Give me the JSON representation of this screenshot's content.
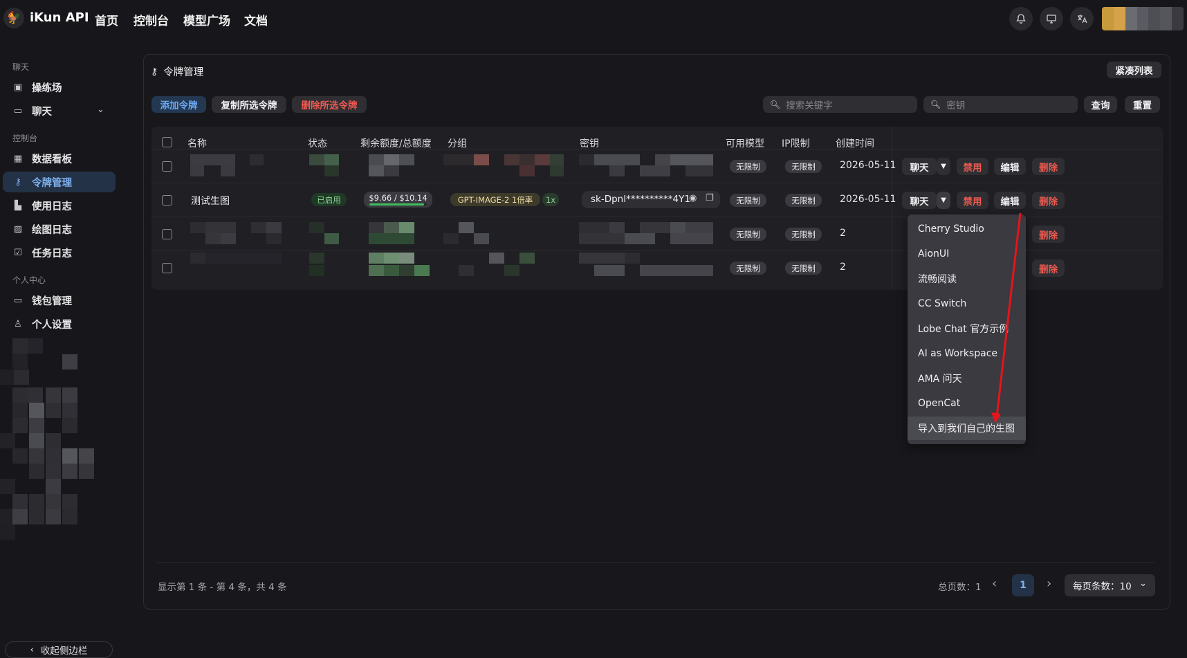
{
  "header": {
    "brand": "iKun API",
    "nav": [
      "首页",
      "控制台",
      "模型广场",
      "文档"
    ]
  },
  "sidebar": {
    "section_chat": "聊天",
    "section_console": "控制台",
    "section_personal": "个人中心",
    "items": [
      {
        "label": "操练场",
        "icon": "playground-icon"
      },
      {
        "label": "聊天",
        "icon": "chat-icon"
      },
      {
        "label": "数据看板",
        "icon": "dashboard-icon"
      },
      {
        "label": "令牌管理",
        "icon": "key-icon"
      },
      {
        "label": "使用日志",
        "icon": "chart-icon"
      },
      {
        "label": "绘图日志",
        "icon": "image-icon"
      },
      {
        "label": "任务日志",
        "icon": "task-icon"
      },
      {
        "label": "钱包管理",
        "icon": "wallet-icon"
      },
      {
        "label": "个人设置",
        "icon": "user-icon"
      }
    ],
    "collapse_label": "收起侧边栏"
  },
  "card": {
    "title": "令牌管理",
    "compact_button": "紧凑列表",
    "add_button": "添加令牌",
    "copy_button": "复制所选令牌",
    "delete_button": "删除所选令牌",
    "search_placeholder": "搜索关键字",
    "key_placeholder": "密钥",
    "query_button": "查询",
    "reset_button": "重置"
  },
  "table": {
    "columns": [
      "名称",
      "状态",
      "剩余额度/总额度",
      "分组",
      "密钥",
      "可用模型",
      "IP限制",
      "创建时间"
    ],
    "unlimited": "无限制",
    "rows": [
      {
        "name": "",
        "date": "2026-05-11"
      },
      {
        "name": "测试生图",
        "status": "已启用",
        "quota": "$9.66 / $10.14",
        "quota_fraction": 0.95,
        "group": "GPT-IMAGE-2 1倍率",
        "ratio": "1x",
        "key": "sk-Dpnl**********4Y1",
        "date": "2026-05-11"
      },
      {
        "name": "",
        "date": "2"
      },
      {
        "name": "",
        "date": "2"
      }
    ],
    "actions": {
      "chat": "聊天",
      "disable": "禁用",
      "edit": "编辑",
      "delete": "删除"
    }
  },
  "dropdown": {
    "items": [
      "Cherry Studio",
      "AionUI",
      "流畅阅读",
      "CC Switch",
      "Lobe Chat 官方示例",
      "AI as Workspace",
      "AMA 问天",
      "OpenCat",
      "导入到我们自己的生图"
    ]
  },
  "footer": {
    "summary": "显示第 1 条 - 第 4 条，共 4 条",
    "total_pages": "总页数：1",
    "current_page": "1",
    "per_page": "每页条数：10"
  },
  "colors": {
    "accent": "#7fb0ef",
    "danger": "#ef5a4f",
    "annotation_arrow": "#e8141b"
  }
}
